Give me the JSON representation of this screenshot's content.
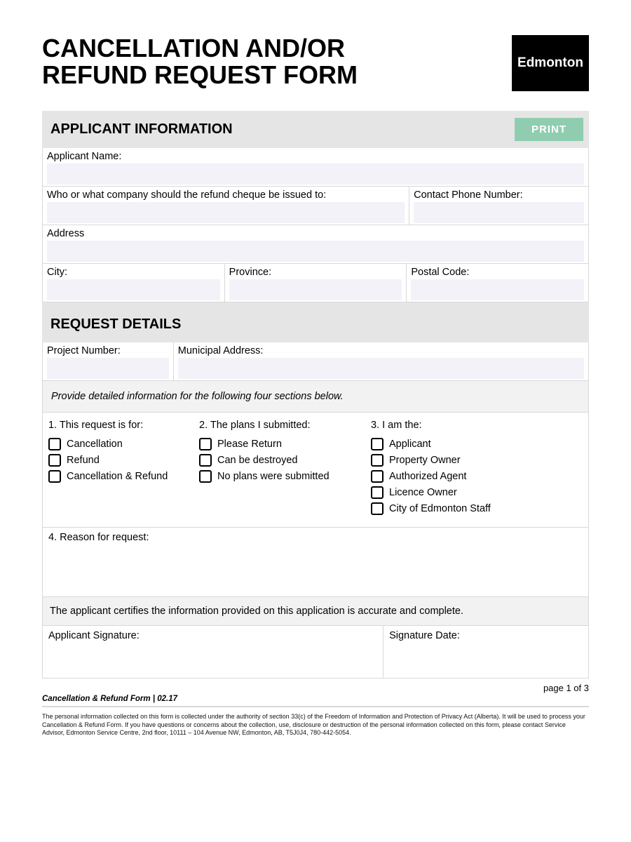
{
  "header": {
    "title_line1": "CANCELLATION AND/OR",
    "title_line2": "REFUND REQUEST FORM",
    "logo": "Edmonton"
  },
  "sections": {
    "applicant_info": {
      "heading": "APPLICANT INFORMATION",
      "print_label": "PRINT",
      "fields": {
        "applicant_name": "Applicant Name:",
        "issued_to": "Who or what company should the refund cheque be issued to:",
        "contact_phone": "Contact Phone Number:",
        "address": "Address",
        "city": "City:",
        "province": "Province:",
        "postal": "Postal Code:"
      }
    },
    "request_details": {
      "heading": "REQUEST DETAILS",
      "project_number": "Project Number:",
      "municipal_address": "Municipal Address:",
      "instruction": "Provide detailed information for the following  four sections below.",
      "q1_title": "1. This request is for:",
      "q1_opts": [
        "Cancellation",
        "Refund",
        "Cancellation & Refund"
      ],
      "q2_title": "2. The plans I submitted:",
      "q2_opts": [
        "Please Return",
        "Can be destroyed",
        "No plans were submitted"
      ],
      "q3_title": "3. I am the:",
      "q3_opts": [
        "Applicant",
        "Property Owner",
        "Authorized Agent",
        "Licence Owner",
        "City of Edmonton Staff"
      ],
      "q4_title": "4. Reason for request:",
      "certification": "The applicant certifies the information provided on this application is accurate and complete.",
      "sig_label": "Applicant Signature:",
      "sig_date_label": "Signature Date:"
    }
  },
  "footer": {
    "page": "page 1 of 3",
    "doc_title": "Cancellation & Refund Form  |  02.17",
    "disclaimer": "The personal information collected on this form is collected under the authority of section 33(c) of the Freedom of Information and Protection of Privacy Act (Alberta). It will be used to process your Cancellation & Refund Form. If you have questions or concerns about the collection, use, disclosure or destruction of the personal information collected on this form, please contact Service Advisor, Edmonton Service Centre, 2nd floor, 10111 – 104 Avenue NW, Edmonton, AB, T5J0J4, 780-442-5054."
  }
}
